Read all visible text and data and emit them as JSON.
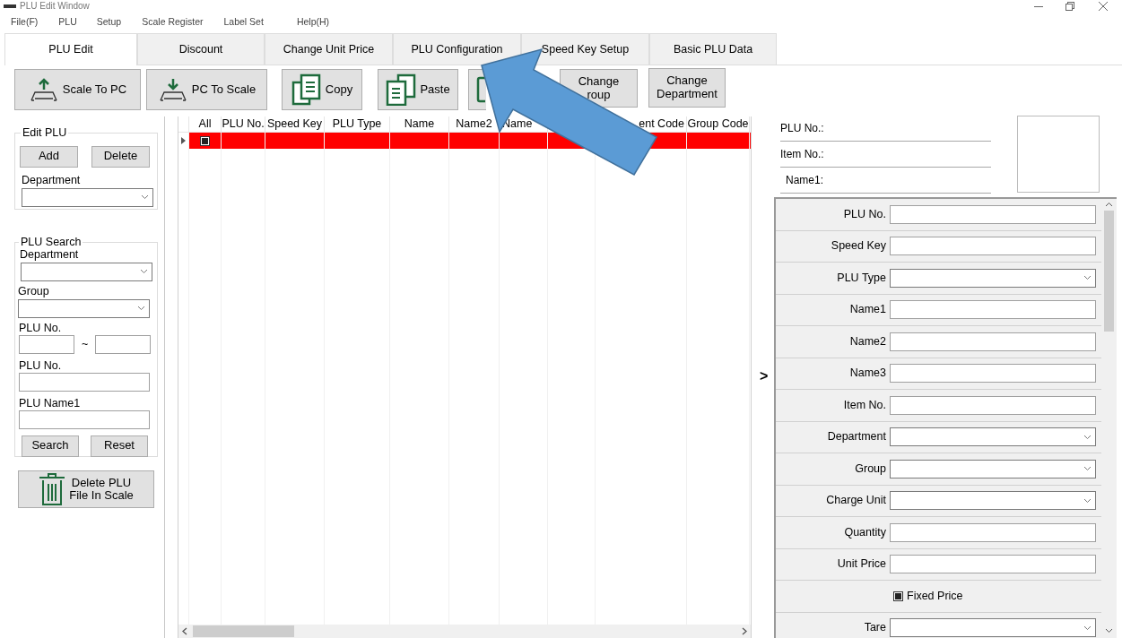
{
  "window": {
    "title": "PLU Edit Window"
  },
  "menu": [
    "File(F)",
    "PLU",
    "Setup",
    "Scale Register",
    "Label Set",
    "Help(H)"
  ],
  "tabs": [
    {
      "label": "PLU Edit",
      "selected": true
    },
    {
      "label": "Discount",
      "selected": false
    },
    {
      "label": "Change Unit Price",
      "selected": false
    },
    {
      "label": "PLU Configuration",
      "selected": false
    },
    {
      "label": "Speed Key Setup",
      "selected": false
    },
    {
      "label": "Basic PLU Data",
      "selected": false
    }
  ],
  "toolbar": [
    {
      "kind": "upload",
      "lines": [
        "Scale To PC"
      ]
    },
    {
      "kind": "download",
      "lines": [
        "PC To Scale"
      ]
    },
    {
      "kind": "copy",
      "lines": [
        "Copy"
      ]
    },
    {
      "kind": "paste",
      "lines": [
        "Paste"
      ]
    },
    {
      "kind": "covered"
    },
    {
      "kind": "text",
      "lines": [
        "Change",
        "roup"
      ]
    },
    {
      "kind": "text",
      "lines": [
        "Change",
        "Department"
      ]
    }
  ],
  "edit_plu": {
    "legend": "Edit PLU",
    "buttons": [
      "Add",
      "Delete"
    ],
    "department_label": "Department"
  },
  "plu_search": {
    "legend": "PLU Search",
    "department_label": "Department",
    "group_label": "Group",
    "range_label": "PLU No.",
    "range_separator": "~",
    "plu_no_label": "PLU No.",
    "name_label": "PLU Name1",
    "buttons": [
      "Search",
      "Reset"
    ]
  },
  "delete_file_button": {
    "lines": [
      "Delete PLU",
      "File In Scale"
    ]
  },
  "grid": {
    "columns": [
      {
        "label": "All"
      },
      {
        "label": "PLU No."
      },
      {
        "label": "Speed Key"
      },
      {
        "label": "PLU Type"
      },
      {
        "label": "Name"
      },
      {
        "label": "Name2"
      },
      {
        "label": "Name"
      },
      {},
      {
        "label": "ent Code"
      },
      {
        "label": "Group Code"
      }
    ],
    "rows": [
      {
        "selected": true,
        "checked": true
      }
    ]
  },
  "expand_toggle": ">",
  "info": [
    "PLU No.:",
    "Item No.:",
    "Name1:"
  ],
  "form": [
    {
      "kind": "text",
      "label": "PLU No."
    },
    {
      "kind": "text",
      "label": "Speed Key"
    },
    {
      "kind": "select",
      "label": "PLU Type"
    },
    {
      "kind": "text",
      "label": "Name1"
    },
    {
      "kind": "text",
      "label": "Name2"
    },
    {
      "kind": "text",
      "label": "Name3"
    },
    {
      "kind": "text",
      "label": "Item No."
    },
    {
      "kind": "select",
      "label": "Department"
    },
    {
      "kind": "select",
      "label": "Group"
    },
    {
      "kind": "select",
      "label": "Charge Unit"
    },
    {
      "kind": "text",
      "label": "Quantity"
    },
    {
      "kind": "text",
      "label": "Unit Price"
    },
    {
      "kind": "checkbox",
      "label": "Fixed Price",
      "checked": true
    },
    {
      "kind": "select",
      "label": "Tare"
    }
  ]
}
